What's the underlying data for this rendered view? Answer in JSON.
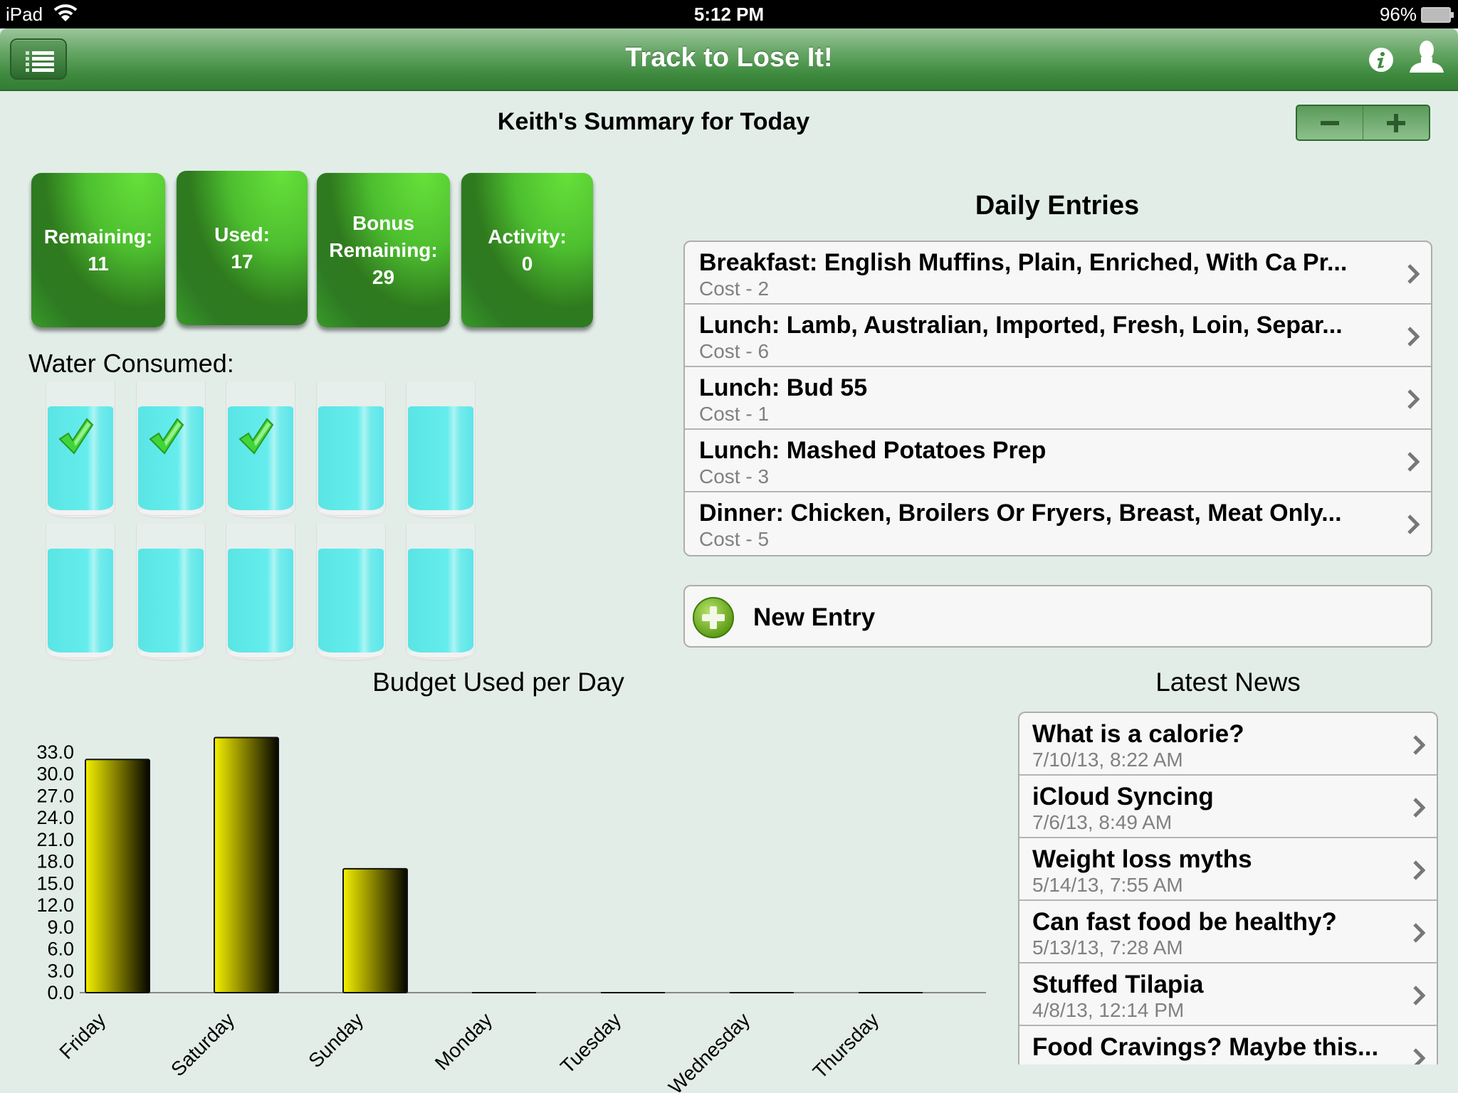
{
  "status_bar": {
    "carrier": "iPad",
    "time": "5:12 PM",
    "battery": "96%"
  },
  "nav": {
    "title": "Track to Lose It!",
    "menu_icon": "list-icon",
    "info_icon": "info-icon",
    "profile_icon": "user-icon"
  },
  "summary": {
    "title": "Keith's Summary for Today",
    "stepper": {
      "minus": "−",
      "plus": "+"
    },
    "tiles": [
      {
        "label": "Remaining:",
        "value": "11"
      },
      {
        "label": "Used:",
        "value": "17"
      },
      {
        "label": "Bonus Remaining:",
        "value": "29"
      },
      {
        "label": "Activity:",
        "value": "0"
      }
    ]
  },
  "water": {
    "label": "Water Consumed:",
    "total_glasses": 10,
    "consumed": 3
  },
  "daily_entries": {
    "title": "Daily Entries",
    "items": [
      {
        "title": "Breakfast: English Muffins, Plain, Enriched, With Ca Pr...",
        "subtitle": "Cost - 2"
      },
      {
        "title": "Lunch: Lamb, Australian, Imported, Fresh, Loin, Separ...",
        "subtitle": "Cost - 6"
      },
      {
        "title": "Lunch: Bud 55",
        "subtitle": "Cost - 1"
      },
      {
        "title": "Lunch: Mashed Potatoes Prep",
        "subtitle": "Cost - 3"
      },
      {
        "title": "Dinner: Chicken, Broilers Or Fryers, Breast, Meat Only...",
        "subtitle": "Cost - 5"
      }
    ],
    "new_entry_label": "New Entry"
  },
  "news": {
    "title": "Latest News",
    "items": [
      {
        "title": "What is a calorie?",
        "date": "7/10/13, 8:22 AM"
      },
      {
        "title": "iCloud Syncing",
        "date": "7/6/13, 8:49 AM"
      },
      {
        "title": "Weight loss myths",
        "date": "5/14/13, 7:55 AM"
      },
      {
        "title": "Can fast food be healthy?",
        "date": "5/13/13, 7:28 AM"
      },
      {
        "title": "Stuffed Tilapia",
        "date": "4/8/13, 12:14 PM"
      },
      {
        "title": "Food Cravings? Maybe this...",
        "date": ""
      }
    ]
  },
  "colors": {
    "background": "#e2ede8",
    "nav_green": "#3e8a3e",
    "tile_green": "#4dbf2f",
    "bar_yellow": "#f4f000",
    "water_cyan": "#4aeaea"
  },
  "chart_data": {
    "type": "bar",
    "title": "Budget Used per Day",
    "xlabel": "",
    "ylabel": "",
    "categories": [
      "Friday",
      "Saturday",
      "Sunday",
      "Monday",
      "Tuesday",
      "Wednesday",
      "Thursday"
    ],
    "values": [
      32,
      35,
      17,
      0,
      0,
      0,
      0
    ],
    "yticks": [
      "0.0",
      "3.0",
      "6.0",
      "9.0",
      "12.0",
      "15.0",
      "18.0",
      "21.0",
      "24.0",
      "27.0",
      "30.0",
      "33.0"
    ],
    "ylim": [
      0,
      33
    ],
    "grid": false,
    "legend": "none"
  }
}
